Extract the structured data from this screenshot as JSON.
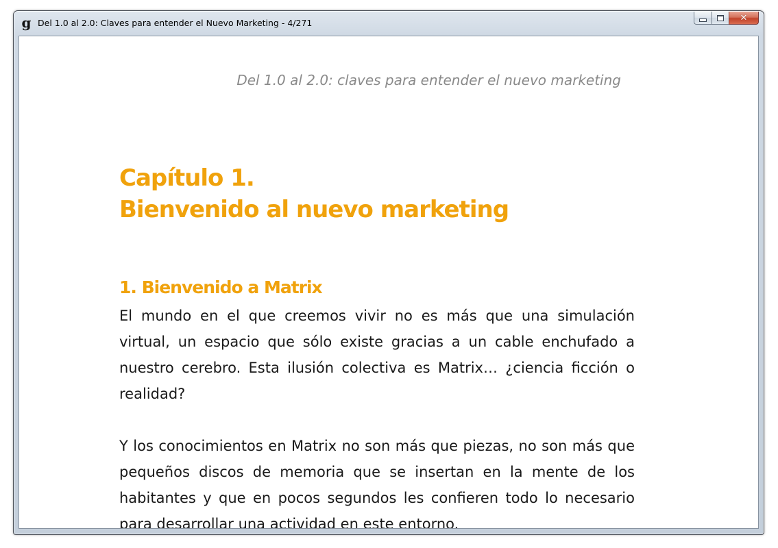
{
  "window": {
    "title": "Del 1.0 al 2.0: Claves para entender el Nuevo Marketing - 4/271",
    "app_icon_glyph": "g",
    "app_icon": "app-g-icon",
    "controls": {
      "minimize_icon": "minimize-icon",
      "maximize_icon": "maximize-icon",
      "close_glyph": "✕",
      "close_icon": "close-icon"
    }
  },
  "page": {
    "running_header": "Del 1.0 al 2.0: claves para entender el nuevo marketing",
    "chapter": {
      "line1": "Capítulo 1.",
      "line2": "Bienvenido al nuevo marketing"
    },
    "section_title": "1. Bienvenido a Matrix",
    "paragraphs": [
      "El mundo en el que creemos vivir no es más que una simulación virtual, un espacio que sólo existe gracias a un cable enchufado a nuestro cerebro. Esta ilusión colectiva es Matrix… ¿ciencia ficción o realidad?",
      "Y los conocimientos en Matrix no son más que piezas, no son más que pequeños discos de memoria que se insertan en la mente de los habitantes y que en pocos segundos les confieren todo lo necesario para desarrollar una actividad en este entorno."
    ],
    "accent_color": "#f0a20c",
    "header_color": "#8a8a8a"
  }
}
